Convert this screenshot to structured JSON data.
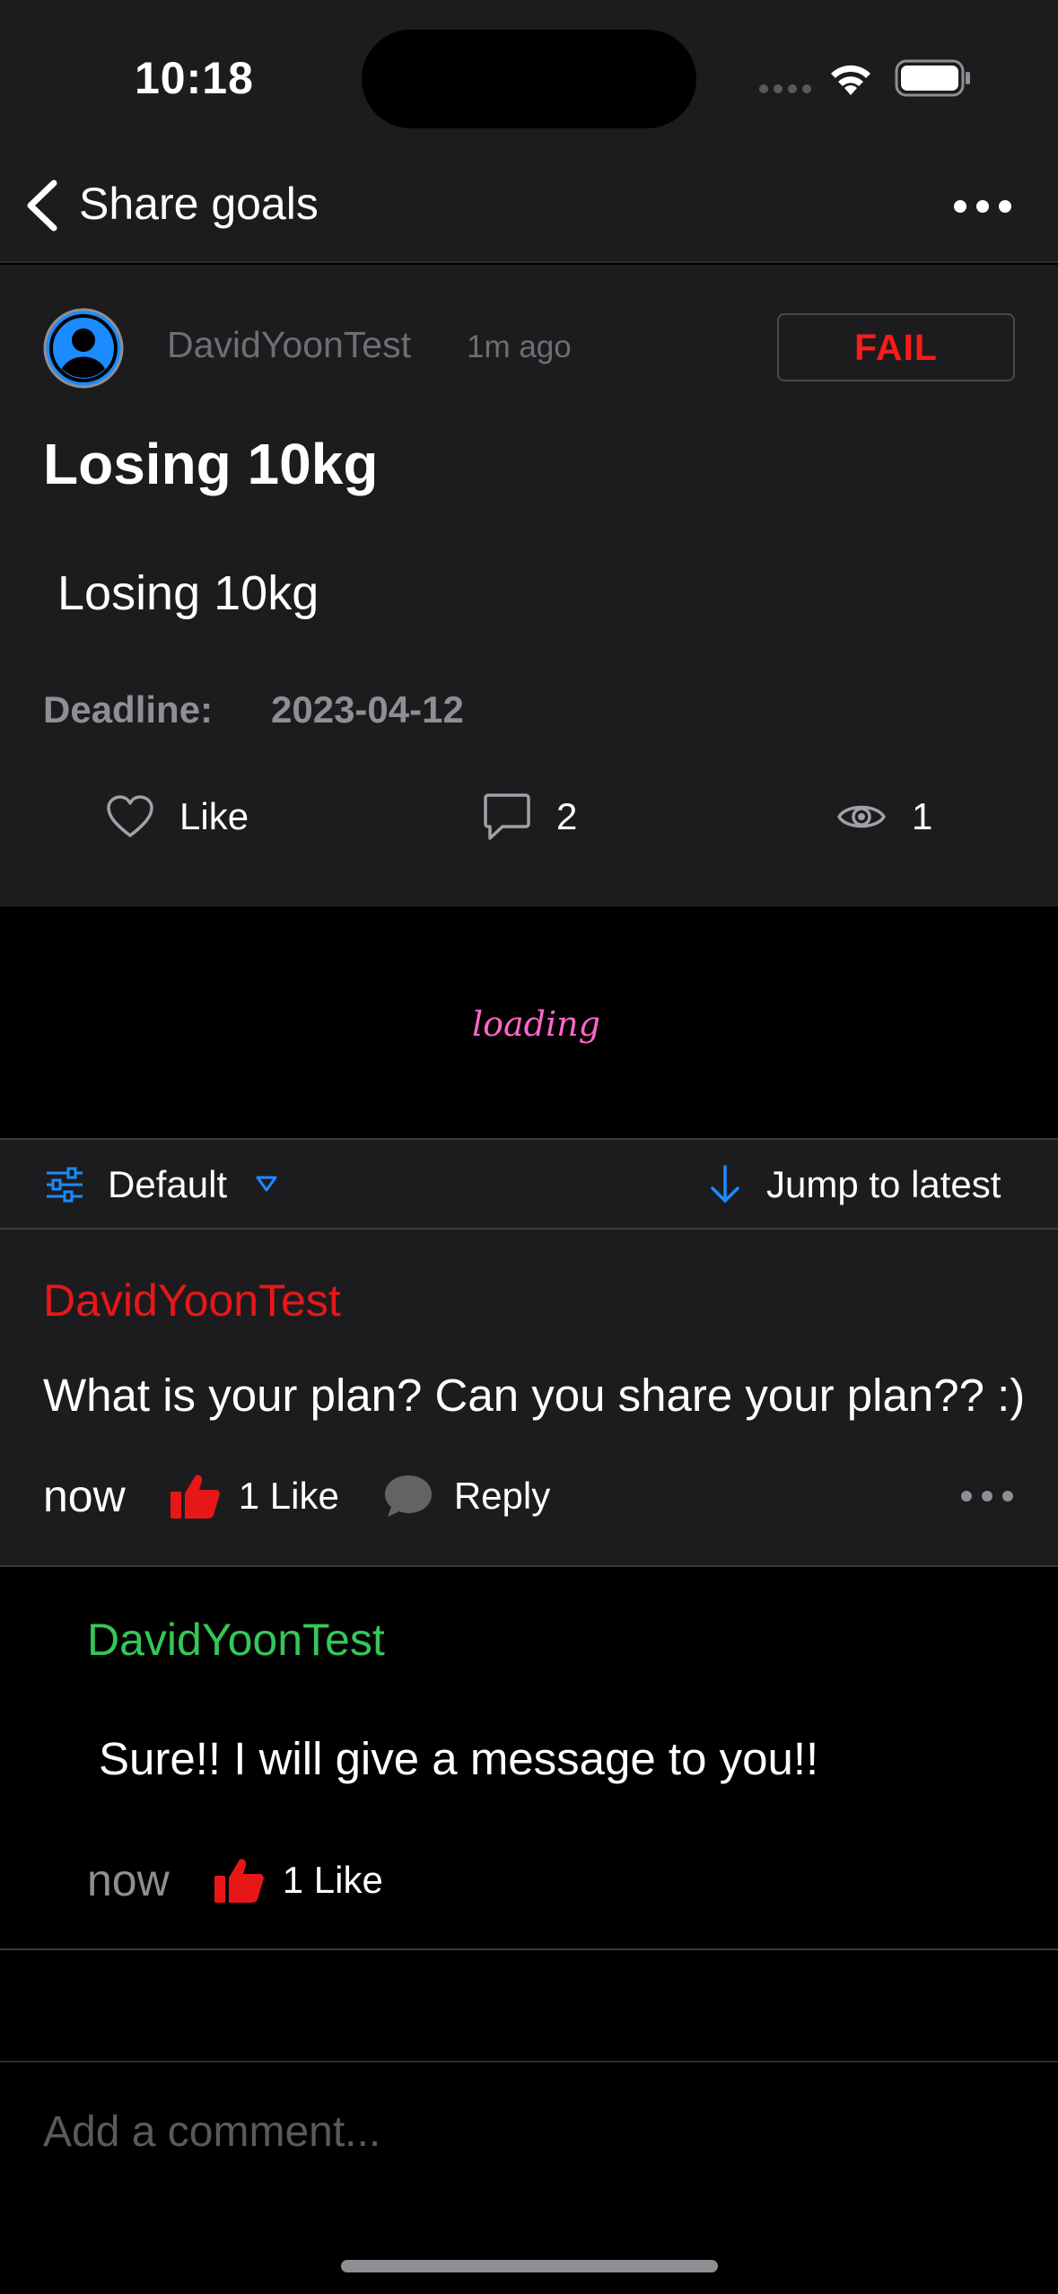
{
  "status_bar": {
    "time": "10:18"
  },
  "nav": {
    "title": "Share goals"
  },
  "post": {
    "author": "DavidYoonTest",
    "time": "1m ago",
    "status_badge": "FAIL",
    "title": "Losing 10kg",
    "body": "Losing 10kg",
    "deadline_label": "Deadline:",
    "deadline_value": "2023-04-12",
    "like_label": "Like",
    "comment_count": "2",
    "view_count": "1"
  },
  "loading": {
    "text": "loading"
  },
  "sort_bar": {
    "sort_label": "Default",
    "jump_label": "Jump to latest"
  },
  "comments": [
    {
      "author": "DavidYoonTest",
      "text": "What is your plan? Can you share your plan?? :)",
      "time": "now",
      "likes": "1 Like",
      "reply_label": "Reply",
      "author_color": "#e81717"
    }
  ],
  "replies": [
    {
      "author": "DavidYoonTest",
      "text": "Sure!! I will give a message to you!!",
      "time": "now",
      "likes": "1 Like",
      "author_color": "#34c759"
    }
  ],
  "composer": {
    "placeholder": "Add a comment..."
  },
  "colors": {
    "accent": "#1a8cff",
    "fail": "#ff1a1a",
    "like": "#e81717",
    "background": "#1c1c1e"
  },
  "icons": {
    "back": "chevron-left-icon",
    "more": "ellipsis-icon",
    "like": "heart-icon",
    "comment": "comment-bubble-icon",
    "views": "eye-icon",
    "filter": "sliders-icon",
    "jump": "arrow-down-icon",
    "thumb": "thumbs-up-icon",
    "reply": "chat-bubble-icon"
  }
}
